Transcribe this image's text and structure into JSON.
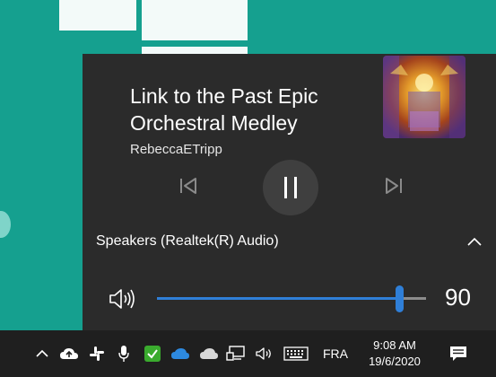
{
  "media": {
    "title": "Link to the Past Epic Orchestral Medley",
    "artist": "RebeccaETripp",
    "state": "playing",
    "album_art_icon": "album-art-thumbnail",
    "controls": {
      "previous": "previous-track-icon",
      "play_pause": "pause-icon",
      "next": "next-track-icon"
    }
  },
  "audio": {
    "device_label": "Speakers (Realtek(R) Audio)",
    "volume_display": "90",
    "volume_level": 90,
    "volume_max": 100
  },
  "taskbar": {
    "language": "FRA",
    "time": "9:08 AM",
    "date": "19/6/2020"
  },
  "colors": {
    "desktop": "#15a08f",
    "flyout_bg": "#2b2b2b",
    "accent": "#2f7fd8",
    "taskbar_bg": "#1f1f1f",
    "security_icon": "#3aab2e",
    "onedrive_blue": "#2d8ae0"
  }
}
